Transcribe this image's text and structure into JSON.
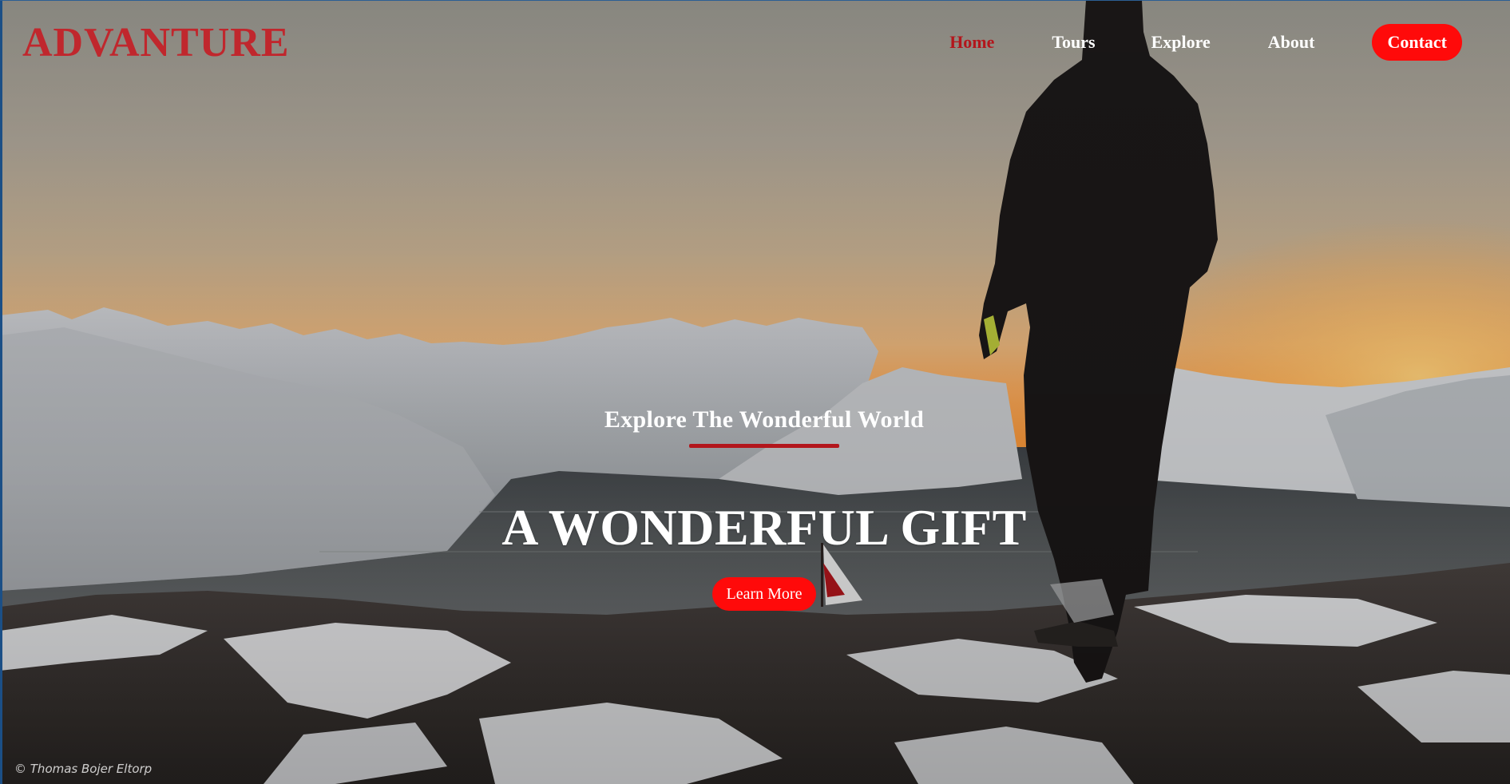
{
  "brand": {
    "logo": "ADVANTURE",
    "color": "#c0272d"
  },
  "nav": {
    "items": [
      {
        "label": "Home",
        "active": true
      },
      {
        "label": "Tours"
      },
      {
        "label": "Explore"
      },
      {
        "label": "About"
      }
    ],
    "contact_label": "Contact",
    "accent": "#ff0a0a",
    "active_color": "#b3161c"
  },
  "hero": {
    "subtitle": "Explore The Wonderful World",
    "headline": "A WONDERFUL GIFT",
    "cta_label": "Learn More"
  },
  "photo_credit": "© Thomas Bojer Eltorp"
}
